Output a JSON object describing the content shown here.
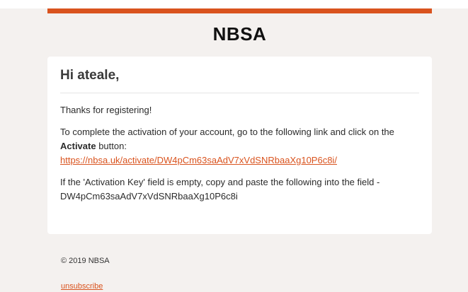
{
  "email": {
    "brand": "NBSA",
    "greeting": "Hi ateale,",
    "thanks": "Thanks for registering!",
    "instruction_prefix": "To complete the activation of your account, go to the following link and click on the",
    "button_word": "Activate",
    "instruction_suffix": "button:",
    "activation_link": "https://nbsa.uk/activate/DW4pCm63saAdV7xVdSNRbaaXg10P6c8i/",
    "fallback_text": "If the 'Activation Key' field is empty, copy and paste the following into the field -",
    "activation_key": "DW4pCm63saAdV7xVdSNRbaaXg10P6c8i"
  },
  "footer": {
    "copyright": "© 2019 NBSA",
    "unsubscribe": "unsubscribe"
  },
  "colors": {
    "accent": "#d9531e",
    "background": "#f4f1ef",
    "card": "#ffffff"
  }
}
